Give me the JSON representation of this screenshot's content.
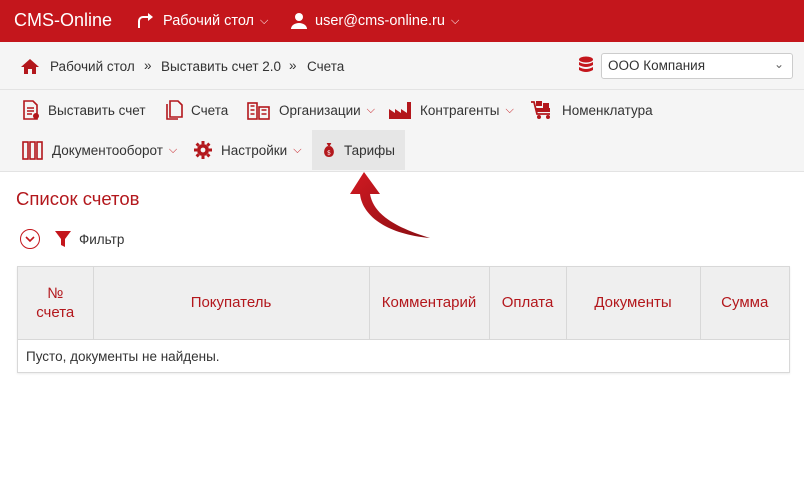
{
  "topbar": {
    "brand": "CMS-Online",
    "desk_label": "Рабочий стол",
    "user_label": "user@cms-online.ru"
  },
  "breadcrumb": {
    "items": [
      "Рабочий стол",
      "Выставить счет 2.0",
      "Счета"
    ],
    "separator": "»"
  },
  "company_select": {
    "value": "ООО Компания"
  },
  "menu": {
    "items": [
      {
        "label": "Выставить счет",
        "icon": "invoice-icon"
      },
      {
        "label": "Счета",
        "icon": "documents-icon"
      },
      {
        "label": "Организации",
        "icon": "buildings-icon",
        "dropdown": true
      },
      {
        "label": "Контрагенты",
        "icon": "factory-icon",
        "dropdown": true
      },
      {
        "label": "Номенклатура",
        "icon": "cart-icon"
      },
      {
        "label": "Документооборот",
        "icon": "binders-icon",
        "dropdown": true
      },
      {
        "label": "Настройки",
        "icon": "gear-icon",
        "dropdown": true
      },
      {
        "label": "Тарифы",
        "icon": "money-bag-icon",
        "active": true
      }
    ]
  },
  "page": {
    "title": "Список счетов",
    "filter_label": "Фильтр"
  },
  "table": {
    "columns": [
      "№ счета",
      "Покупатель",
      "Комментарий",
      "Оплата",
      "Документы",
      "Сумма"
    ],
    "empty_text": "Пусто, документы не найдены."
  },
  "colors": {
    "brand": "#c4161c",
    "accent_text": "#b3171c"
  }
}
